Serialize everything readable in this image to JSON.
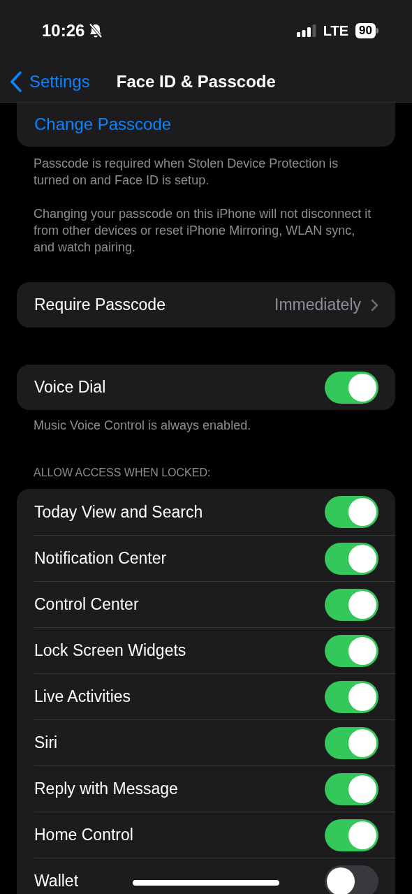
{
  "status_bar": {
    "time": "10:26",
    "silent": true,
    "network": "LTE",
    "battery": "90"
  },
  "nav": {
    "back": "Settings",
    "title": "Face ID & Passcode"
  },
  "change_passcode": "Change Passcode",
  "change_passcode_notes": [
    "Passcode is required when Stolen Device Protection is turned on and Face ID is setup.",
    "Changing your passcode on this iPhone will not disconnect it from other devices or reset iPhone Mirroring, WLAN sync, and watch pairing."
  ],
  "require_passcode": {
    "label": "Require Passcode",
    "value": "Immediately"
  },
  "voice_dial": {
    "label": "Voice Dial",
    "on": true
  },
  "voice_dial_note": "Music Voice Control is always enabled.",
  "locked_access": {
    "header": "ALLOW ACCESS WHEN LOCKED:",
    "items": [
      {
        "label": "Today View and Search",
        "on": true
      },
      {
        "label": "Notification Center",
        "on": true
      },
      {
        "label": "Control Center",
        "on": true
      },
      {
        "label": "Lock Screen Widgets",
        "on": true
      },
      {
        "label": "Live Activities",
        "on": true
      },
      {
        "label": "Siri",
        "on": true
      },
      {
        "label": "Reply with Message",
        "on": true
      },
      {
        "label": "Home Control",
        "on": true
      },
      {
        "label": "Wallet",
        "on": false
      }
    ]
  }
}
